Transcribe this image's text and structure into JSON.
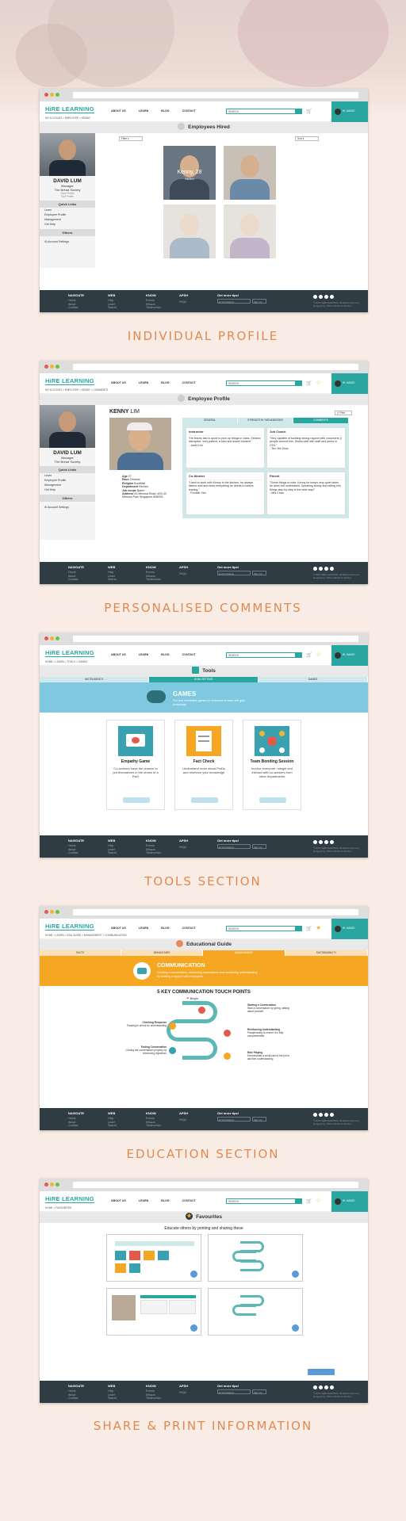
{
  "nav": {
    "logo": "HiRE LEARNING",
    "links": [
      "ABOUT US",
      "LEARN",
      "BLOG",
      "CONTACT"
    ],
    "search_placeholder": "SEARCH",
    "user": "HI, DAVID!"
  },
  "footer": {
    "navigate": {
      "title": "NAVIGATE",
      "items": [
        "Home",
        "About",
        "Contact"
      ]
    },
    "web": {
      "title": "WEB",
      "items": [
        "Help",
        "Learn",
        "Search"
      ]
    },
    "know": {
      "title": "KNOW",
      "items": [
        "Events",
        "Mission",
        "Testimonies"
      ]
    },
    "apsh": "APSH",
    "faqs": "FAQs",
    "news_title": "Get more tips!",
    "email_placeholder": "Email Address",
    "signup": "Sign Up",
    "copyright": "© 2015 HIRE LEARNING. All Rights Reserved. Designed by TOM LASKAR & NICOLA"
  },
  "s1": {
    "breadcrumb": "MY ACCOUNT > EMPLOYEE > KENNY",
    "title": "Employees Hired",
    "filter": "Filter",
    "sort": "Sort",
    "profile": {
      "name": "DAVID LUM",
      "role": "Manager",
      "org": "The Bread Society",
      "link1": "View Profile",
      "link2": "Edit Profile"
    },
    "quick_links": "Quick Links",
    "links": [
      "Learn",
      "Employee Profile",
      "Management",
      "Get Help"
    ],
    "others": "Others",
    "account": "Account Settings",
    "hover_name": "Kenny, 28",
    "hover_sub": "Kitchen",
    "caption": "INDIVIDUAL PROFILE"
  },
  "s2": {
    "breadcrumb": "MY ACCOUNT > EMPLOYEE > KENNY > COMMENTS",
    "title": "Employee Profile",
    "name_first": "KENNY",
    "name_last": "LIM",
    "print": "Print",
    "details": [
      {
        "k": "Age",
        "v": "27"
      },
      {
        "k": "Race",
        "v": "Chinese"
      },
      {
        "k": "Religion",
        "v": "Buddhist"
      },
      {
        "k": "Department",
        "v": "Kitchen"
      },
      {
        "k": "Job scope",
        "v": "Baker"
      },
      {
        "k": "Address",
        "v": "43 Mimosa Road, #03-43 Mimosa Park Singapore 808005"
      }
    ],
    "tabs": [
      "GENERAL",
      "STRENGTHS / WEAKNESSES",
      "COMMENTS"
    ],
    "comments": [
      {
        "title": "Instructor",
        "text": "\"He learns fast is quick to pick up things in class. Seldom disruptive, very patient, a kind and sweet student.\"",
        "by": "- Janet Lim"
      },
      {
        "title": "Job Coach",
        "text": "\"Very capable of building strong rapport with customers (I people around him. Works well with staff and peers in CFA.\"",
        "by": "- Teo Yee Hoor"
      },
      {
        "title": "Co-Worker",
        "text": "\"Used to work with Kenny in the kitchen, he always listens well and does everything he needs to before leaving.\"",
        "by": "- Freddie Sim"
      },
      {
        "title": "Parent",
        "text": "\"Some things to note: Kenny he keeps very quiet when he does not understand. Speaking slowly and telling him things step by step is the best way!\"",
        "by": "- Mrs Chan"
      }
    ],
    "caption": "PERSONALISED COMMENTS"
  },
  "s3": {
    "breadcrumb": "HOME > LEARN > TOOLS > GAMES",
    "title": "Tools",
    "tabs": [
      "INSTRUMENTS",
      "GOAL SETTING",
      "GAMES"
    ],
    "banner_title": "GAMES",
    "banner_sub": "Fun and interactive games for everyone to learn and gain knowledge",
    "tools": [
      {
        "title": "Empathy Game",
        "desc": "Co-workers have the chance to put themselves in the shoes of a PwD"
      },
      {
        "title": "Fact Check",
        "desc": "Understand more about PwDs and reinforce your knowledge"
      },
      {
        "title": "Team Bonding Session",
        "desc": "Involve everyone; mingle and interact with co-workers from other departments"
      }
    ],
    "caption": "TOOLS SECTION"
  },
  "s4": {
    "breadcrumb": "HOME > LEARN > EDU GUIDE > MANAGEMENT > COMMUNICATION",
    "title": "Educational Guide",
    "tabs": [
      "FACTS",
      "BEHAVIOURS",
      "MANAGEMENT",
      "SUSTAINABILITY"
    ],
    "banner_title": "COMMUNICATION",
    "banner_sub": "Creating a conversation, reinforcing expectations and monitoring understanding by building a rapport with employees",
    "section_title": "5 KEY COMMUNICATION TOUCH POINTS",
    "begin": "Begin",
    "points": [
      {
        "title": "Starting a Conversation",
        "text": "Start a conversation by giving, talking about yourself"
      },
      {
        "title": "Checking Response",
        "text": "Pausing to check for understanding"
      },
      {
        "title": "Reinforcing Understanding",
        "text": "Paraphrasing to ensure it is fully comprehended"
      },
      {
        "title": "Ending Conversation",
        "text": "Closing the conversation properly by reinforcing objectives"
      },
      {
        "title": "Role Playing",
        "text": "Demonstrate a small part of the job to aid their understanding"
      }
    ],
    "caption": "EDUCATION SECTION"
  },
  "s5": {
    "breadcrumb": "HOME > FAVOURITES",
    "title": "Favourites",
    "subtitle": "Educate others by printing and sharing these",
    "caption": "SHARE & PRINT INFORMATION"
  },
  "colors": {
    "teal": "#2aa6a0",
    "orange": "#f5a623",
    "footer": "#2f3c44",
    "caption": "#e08a52"
  }
}
